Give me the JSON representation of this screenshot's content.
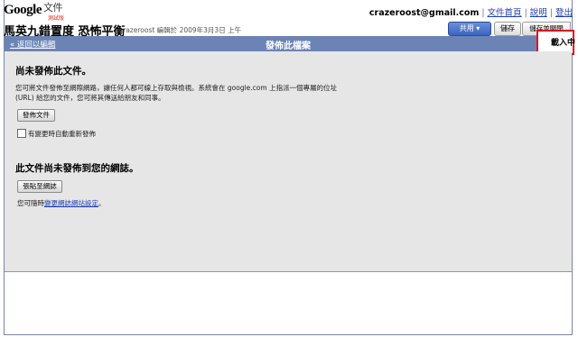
{
  "app": {
    "logo_google": "Google",
    "logo_product": "文件",
    "logo_beta": "測試版"
  },
  "userbar": {
    "email": "crazeroost@gmail.com",
    "links": [
      "文件首頁",
      "說明",
      "登出"
    ]
  },
  "document": {
    "title": "馬英九錯置度 恐怖平衡",
    "edit_info": "crazeroost 編輯於 2009年3月3日 上午"
  },
  "toolbar": {
    "share_label": "共用 ▾",
    "save_label": "儲存",
    "save_close_label": "儲存並關閉"
  },
  "publish_bar": {
    "back_link": "« 返回以編輯",
    "title": "發佈此檔案",
    "loading": "載入中"
  },
  "section_publish": {
    "heading": "尚未發佈此文件。",
    "description_line1": "您可將文件發佈至網際網路，讓任何人都可線上存取與檢視。系統會在 google.com 上指派一個專屬的位址",
    "description_line2": "(URL) 給您的文件，您可將其傳送給朋友和同事。",
    "publish_button": "發佈文件",
    "auto_republish_label": "有變更時自動重新發佈",
    "auto_republish_checked": false
  },
  "section_blog": {
    "heading": "此文件尚未發佈到您的網誌。",
    "post_button": "張貼至網誌",
    "settings_prefix": "您可隨時",
    "settings_link": "變更網誌網站設定",
    "settings_suffix": "。"
  },
  "colors": {
    "publish_bar_bg": "#6c84b5",
    "panel_bg": "#e6e6e6",
    "link": "#1f3eb2",
    "highlight_box": "#e0111a"
  }
}
